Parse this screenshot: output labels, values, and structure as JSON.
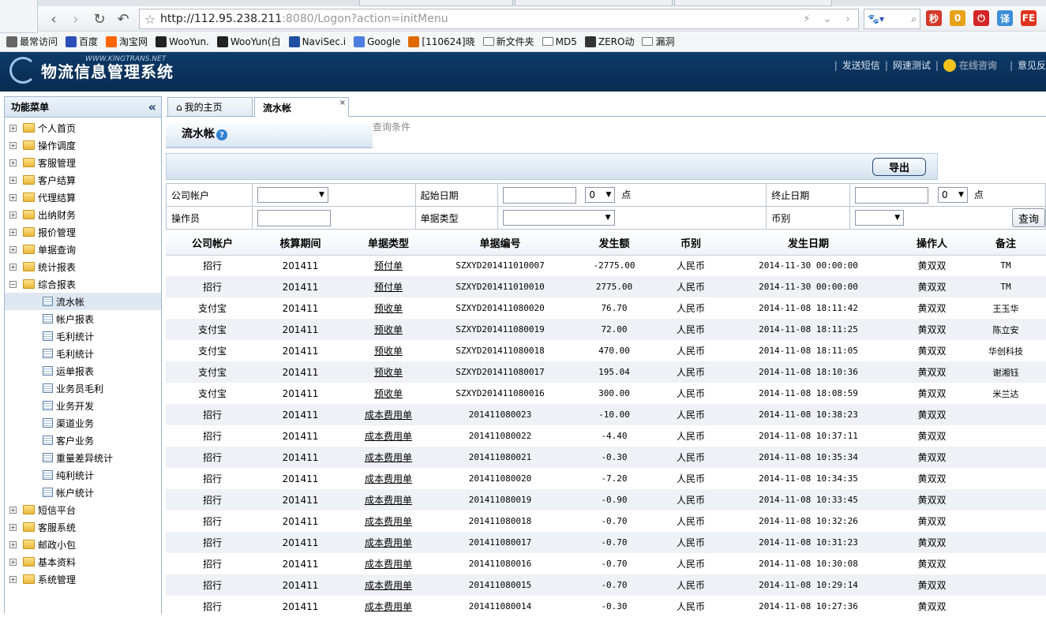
{
  "browser": {
    "url_host": "http://112.95.238.211",
    "url_rest": ":8080/Logon?action=initMenu",
    "bookmarks": [
      {
        "label": "最常访问",
        "icon": "page-icon",
        "color": "#666666"
      },
      {
        "label": "百度",
        "icon": "baidu-icon",
        "color": "#2b4fb8"
      },
      {
        "label": "淘宝网",
        "icon": "taobao-icon",
        "color": "#ff6600"
      },
      {
        "label": "WooYun.",
        "icon": "wooyun-icon",
        "color": "#222222"
      },
      {
        "label": "WooYun(白",
        "icon": "wooyun-icon",
        "color": "#222222"
      },
      {
        "label": "NaviSec.i",
        "icon": "navisec-icon",
        "color": "#1f4ea3"
      },
      {
        "label": "Google",
        "icon": "google-icon",
        "color": "#4a7fe0"
      },
      {
        "label": "[110624]晓",
        "icon": "feed-icon",
        "color": "#e06a00"
      },
      {
        "label": "新文件夹",
        "icon": "folder-icon",
        "color": ""
      },
      {
        "label": "MD5",
        "icon": "folder-icon",
        "color": ""
      },
      {
        "label": "ZERO动",
        "icon": "zero-icon",
        "color": "#333333"
      },
      {
        "label": "漏洞",
        "icon": "folder-icon",
        "color": ""
      }
    ],
    "ext_icons": [
      {
        "name": "weibo-icon",
        "glyph": "秒",
        "color": "#d43a2a"
      },
      {
        "name": "puzzle-icon",
        "glyph": "0",
        "color": "#e8a21a"
      },
      {
        "name": "power-icon",
        "glyph": "⏻",
        "color": "#d42626"
      },
      {
        "name": "translate-icon",
        "glyph": "译",
        "color": "#3d8fd8"
      },
      {
        "name": "fe-icon",
        "glyph": "FE",
        "color": "#e0341f"
      }
    ]
  },
  "app": {
    "title": "物流信息管理系统",
    "subtitle": "WWW.KINGTRANS.NET",
    "header_links": [
      "发送短信",
      "网速测试"
    ],
    "online_label": "在线咨询",
    "feedback_label": "意见反"
  },
  "sidebar": {
    "title": "功能菜单",
    "collapse": "«",
    "nodes_before": [
      "个人首页",
      "操作调度",
      "客服管理",
      "客户结算",
      "代理结算",
      "出纳财务",
      "报价管理",
      "单据查询",
      "统计报表"
    ],
    "expanded_node": "综合报表",
    "children": [
      "流水帐",
      "帐户报表",
      "毛利统计",
      "毛利统计",
      "运单报表",
      "业务员毛利",
      "业务开发",
      "渠道业务",
      "客户业务",
      "重量差异统计",
      "纯利统计",
      "帐户统计"
    ],
    "active_child_index": 0,
    "nodes_after": [
      "短信平台",
      "客服系统",
      "邮政小包",
      "基本资料",
      "系统管理"
    ]
  },
  "tabs": {
    "home": "我的主页",
    "active": "流水帐",
    "close": "×"
  },
  "page": {
    "title": "流水帐",
    "help": "?",
    "query_label": "查询条件",
    "export_label": "导出"
  },
  "filter": {
    "company_account_label": "公司帐户",
    "start_date_label": "起始日期",
    "start_hour": "0",
    "hour_unit": "点",
    "end_date_label": "终止日期",
    "end_hour": "0",
    "operator_label": "操作员",
    "doc_type_label": "单据类型",
    "currency_label": "币别",
    "query_button": "查询"
  },
  "table": {
    "columns": [
      "公司帐户",
      "核算期间",
      "单据类型",
      "单据编号",
      "发生额",
      "币别",
      "发生日期",
      "操作人",
      "备注"
    ],
    "rows": [
      [
        "招行",
        "201411",
        "预付单",
        "SZXYD201411010007",
        "-2775.00",
        "人民币",
        "2014-11-30 00:00:00",
        "黄双双",
        "TM"
      ],
      [
        "招行",
        "201411",
        "预付单",
        "SZXYD201411010010",
        "2775.00",
        "人民币",
        "2014-11-30 00:00:00",
        "黄双双",
        "TM"
      ],
      [
        "支付宝",
        "201411",
        "预收单",
        "SZXYD201411080020",
        "76.70",
        "人民币",
        "2014-11-08 18:11:42",
        "黄双双",
        "王玉华"
      ],
      [
        "支付宝",
        "201411",
        "预收单",
        "SZXYD201411080019",
        "72.00",
        "人民币",
        "2014-11-08 18:11:25",
        "黄双双",
        "陈立安"
      ],
      [
        "支付宝",
        "201411",
        "预收单",
        "SZXYD201411080018",
        "470.00",
        "人民币",
        "2014-11-08 18:11:05",
        "黄双双",
        "华创科技"
      ],
      [
        "支付宝",
        "201411",
        "预收单",
        "SZXYD201411080017",
        "195.04",
        "人民币",
        "2014-11-08 18:10:36",
        "黄双双",
        "谢湘钰"
      ],
      [
        "支付宝",
        "201411",
        "预收单",
        "SZXYD201411080016",
        "300.00",
        "人民币",
        "2014-11-08 18:08:59",
        "黄双双",
        "米兰达"
      ],
      [
        "招行",
        "201411",
        "成本费用单",
        "201411080023",
        "-10.00",
        "人民币",
        "2014-11-08 10:38:23",
        "黄双双",
        ""
      ],
      [
        "招行",
        "201411",
        "成本费用单",
        "201411080022",
        "-4.40",
        "人民币",
        "2014-11-08 10:37:11",
        "黄双双",
        ""
      ],
      [
        "招行",
        "201411",
        "成本费用单",
        "201411080021",
        "-0.30",
        "人民币",
        "2014-11-08 10:35:34",
        "黄双双",
        ""
      ],
      [
        "招行",
        "201411",
        "成本费用单",
        "201411080020",
        "-7.20",
        "人民币",
        "2014-11-08 10:34:35",
        "黄双双",
        ""
      ],
      [
        "招行",
        "201411",
        "成本费用单",
        "201411080019",
        "-0.90",
        "人民币",
        "2014-11-08 10:33:45",
        "黄双双",
        ""
      ],
      [
        "招行",
        "201411",
        "成本费用单",
        "201411080018",
        "-0.70",
        "人民币",
        "2014-11-08 10:32:26",
        "黄双双",
        ""
      ],
      [
        "招行",
        "201411",
        "成本费用单",
        "201411080017",
        "-0.70",
        "人民币",
        "2014-11-08 10:31:23",
        "黄双双",
        ""
      ],
      [
        "招行",
        "201411",
        "成本费用单",
        "201411080016",
        "-0.70",
        "人民币",
        "2014-11-08 10:30:08",
        "黄双双",
        ""
      ],
      [
        "招行",
        "201411",
        "成本费用单",
        "201411080015",
        "-0.70",
        "人民币",
        "2014-11-08 10:29:14",
        "黄双双",
        ""
      ],
      [
        "招行",
        "201411",
        "成本费用单",
        "201411080014",
        "-0.30",
        "人民币",
        "2014-11-08 10:27:36",
        "黄双双",
        ""
      ]
    ]
  }
}
